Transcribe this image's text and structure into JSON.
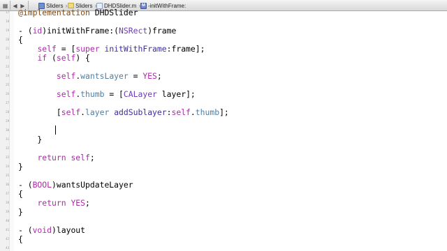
{
  "jump_bar": {
    "back_icon": "chevron-left-icon",
    "forward_icon": "chevron-right-icon",
    "related_icon": "grid-icon",
    "breadcrumbs": [
      {
        "label": "Sliders",
        "icon": "project-icon"
      },
      {
        "label": "Sliders",
        "icon": "folder-icon"
      },
      {
        "label": "DHDSlider.m",
        "icon": "m-file-icon"
      },
      {
        "label": "-initWithFrame:",
        "icon": "method-icon"
      }
    ]
  },
  "editor": {
    "line_numbers": [
      "17",
      "18",
      "19",
      "20",
      "21",
      "22",
      "23",
      "24",
      "25",
      "26",
      "27",
      "28",
      "29",
      "30",
      "31",
      "32",
      "33",
      "34",
      "35",
      "36",
      "37",
      "38",
      "39",
      "40",
      "41",
      "42",
      "43",
      "44"
    ],
    "code_lines": [
      "@implementation DHDSlider",
      "",
      "- (id)initWithFrame:(NSRect)frame",
      "{",
      "    self = [super initWithFrame:frame];",
      "    if (self) {",
      "",
      "        self.wantsLayer = YES;",
      "",
      "        self.thumb = [CALayer layer];",
      "",
      "        [self.layer addSublayer:self.thumb];",
      "",
      "",
      "    }",
      "",
      "    return self;",
      "}",
      "",
      "- (BOOL)wantsUpdateLayer",
      "{",
      "    return YES;",
      "}",
      "",
      "- (void)layout",
      "{"
    ]
  },
  "colors": {
    "keyword": "#ad2aa8",
    "class": "#6a3cb0",
    "method": "#3b2f9c",
    "property": "#4e7fa3",
    "directive": "#7d4a16"
  }
}
